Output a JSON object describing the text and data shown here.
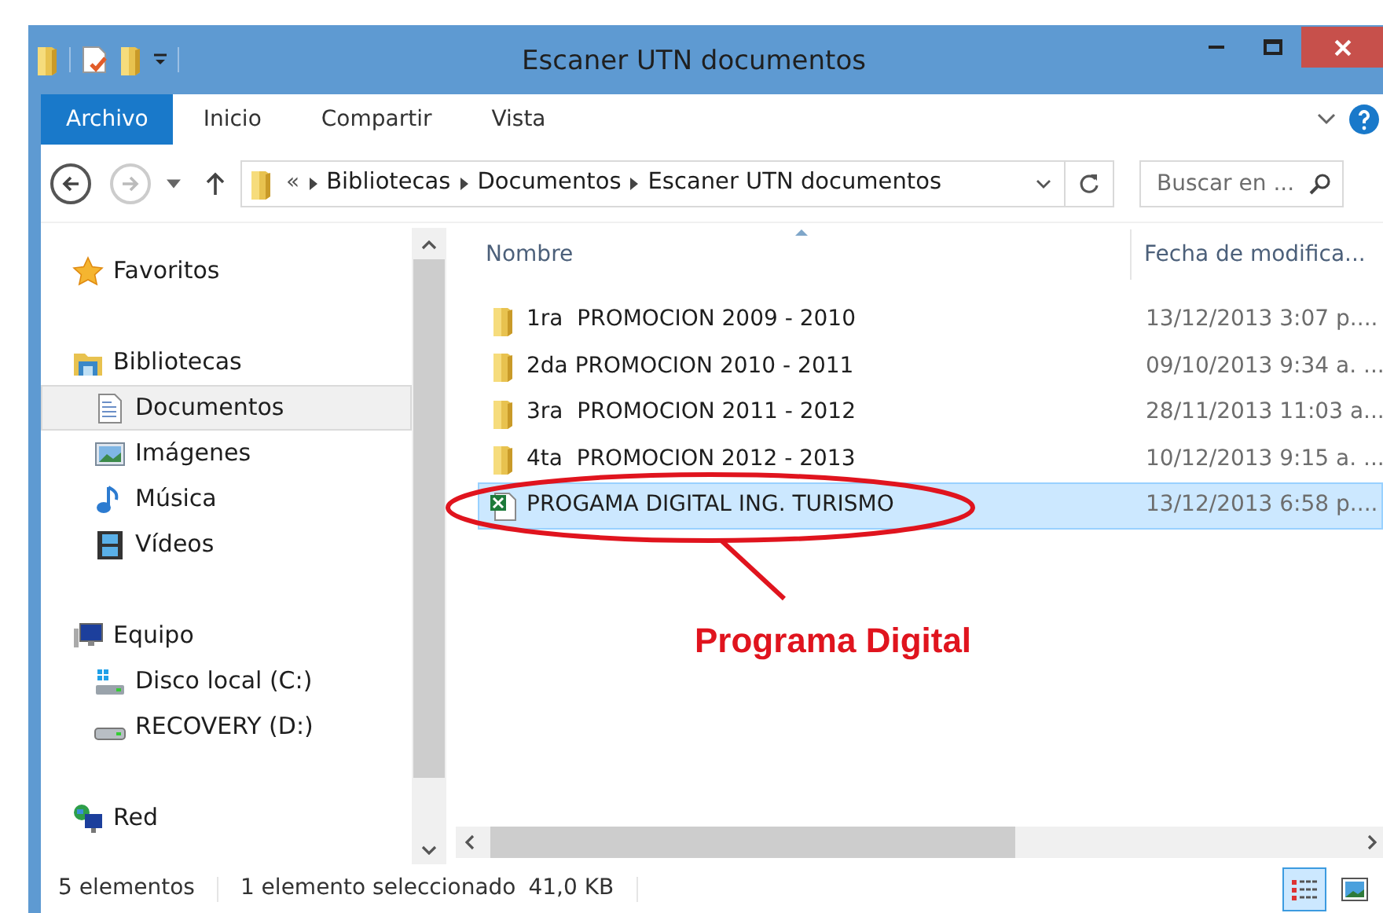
{
  "window": {
    "title": "Escaner UTN documentos"
  },
  "ribbon_tabs": [
    {
      "label": "Archivo",
      "selected": true
    },
    {
      "label": "Inicio",
      "selected": false
    },
    {
      "label": "Compartir",
      "selected": false
    },
    {
      "label": "Vista",
      "selected": false
    }
  ],
  "address": {
    "overflow": "«",
    "path": [
      "Bibliotecas",
      "Documentos",
      "Escaner UTN documentos"
    ]
  },
  "search": {
    "placeholder": "Buscar en ..."
  },
  "nav": [
    {
      "label": "Favoritos",
      "kind": "star",
      "selected": false
    },
    {
      "label": "Bibliotecas",
      "kind": "library",
      "selected": false,
      "children": [
        {
          "label": "Documentos",
          "kind": "document",
          "selected": true
        },
        {
          "label": "Imágenes",
          "kind": "image",
          "selected": false
        },
        {
          "label": "Música",
          "kind": "music",
          "selected": false
        },
        {
          "label": "Vídeos",
          "kind": "video",
          "selected": false
        }
      ]
    },
    {
      "label": "Equipo",
      "kind": "computer",
      "selected": false,
      "children": [
        {
          "label": "Disco local (C:)",
          "kind": "disk",
          "selected": false
        },
        {
          "label": "RECOVERY (D:)",
          "kind": "drive",
          "selected": false
        }
      ]
    },
    {
      "label": "Red",
      "kind": "network",
      "selected": false
    }
  ],
  "columns": [
    "Nombre",
    "Fecha de modifica..."
  ],
  "files": [
    {
      "name": "1ra  PROMOCION 2009 - 2010",
      "date": "13/12/2013 3:07 p....",
      "kind": "folder",
      "selected": false
    },
    {
      "name": "2da PROMOCION 2010 - 2011",
      "date": "09/10/2013 9:34 a. ...",
      "kind": "folder",
      "selected": false
    },
    {
      "name": "3ra  PROMOCION 2011 - 2012",
      "date": "28/11/2013 11:03 a...",
      "kind": "folder",
      "selected": false
    },
    {
      "name": "4ta  PROMOCION 2012 - 2013",
      "date": "10/12/2013 9:15 a. ...",
      "kind": "folder",
      "selected": false
    },
    {
      "name": "PROGAMA DIGITAL ING. TURISMO",
      "date": "13/12/2013 6:58 p....",
      "kind": "spreadsheet",
      "selected": true
    }
  ],
  "annotation": {
    "label": "Programa Digital"
  },
  "status_bar": {
    "count": "5 elementos",
    "selection": "1 elemento seleccionado",
    "size": "41,0 KB"
  },
  "views": [
    {
      "kind": "details",
      "selected": true
    },
    {
      "kind": "thumbnails",
      "selected": false
    }
  ]
}
